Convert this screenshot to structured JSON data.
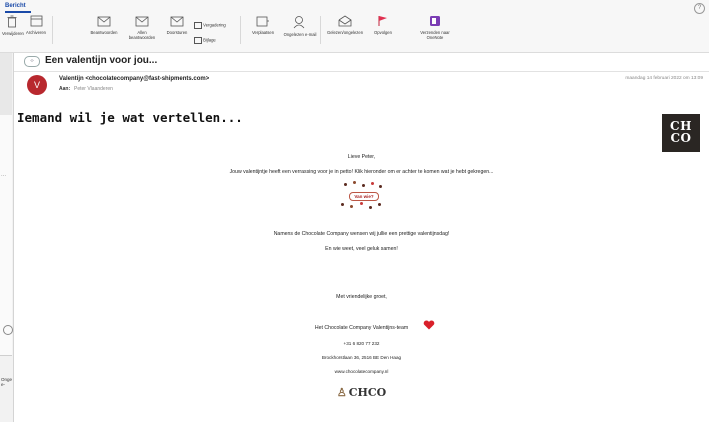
{
  "ribbon": {
    "tab": "Bericht",
    "buttons": [
      {
        "label": "Verwijderen",
        "icon": "trash-icon"
      },
      {
        "label": "Archiveren",
        "icon": "archive-icon"
      },
      {
        "label": "Beantwoorden",
        "icon": "reply-icon"
      },
      {
        "label": "Allen beantwoorden",
        "icon": "reply-all-icon"
      },
      {
        "label": "Doorsturen",
        "icon": "forward-icon"
      },
      {
        "label": "Verplaatsen",
        "icon": "move-icon"
      },
      {
        "label": "Ongelezen e-mail",
        "icon": "unread-icon"
      },
      {
        "label": "Gelezen/ongelezen",
        "icon": "envelope-open-icon"
      },
      {
        "label": "Opvolgen",
        "icon": "flag-icon"
      },
      {
        "label": "Verzenden naar OneNote",
        "icon": "onenote-icon"
      }
    ],
    "small_buttons": [
      {
        "label": "Vergadering",
        "icon": "meeting-icon"
      },
      {
        "label": "Bijlage",
        "icon": "attachment-icon"
      }
    ]
  },
  "left_pane": {
    "label": "Onge e-"
  },
  "message": {
    "subject": "Een valentijn voor jou...",
    "avatar_initial": "V",
    "sender": "Valentijn <chocolatecompany@fast-shipments.com>",
    "to_label": "Aan:",
    "to_value": "Peter Vlaanderen",
    "date": "maandag 14 februari 2022 om 13:09"
  },
  "body": {
    "headline": "Iemand wil je wat vertellen...",
    "logo_line1": "CH",
    "logo_line2": "CO",
    "greeting": "Lieve Peter,",
    "intro": "Jouw valentijntje heeft een verrassing voor je in petto! Klik hieronder om er achter te komen wat je hebt gekregen...",
    "cta": "Van wie?",
    "wish1": "Namens de Chocolate Company wensen wij jullie een prettige valentijnsdag!",
    "wish2": "En wie weet, veel geluk samen!",
    "closing": "Met vriendelijke groet,",
    "signature": "Het Chocolate Company Valentijns-team",
    "phone": "+31 6 820 77 232",
    "address": "Brockhorstlaan 36, 2516 BE Den Haag",
    "website": "www.chocolatecompany.nl",
    "footer_logo": "CHCO"
  },
  "colors": {
    "accent": "#1a4aa8",
    "avatar": "#b8282e",
    "heart": "#d9202a",
    "logo_bg": "#2a2623"
  }
}
